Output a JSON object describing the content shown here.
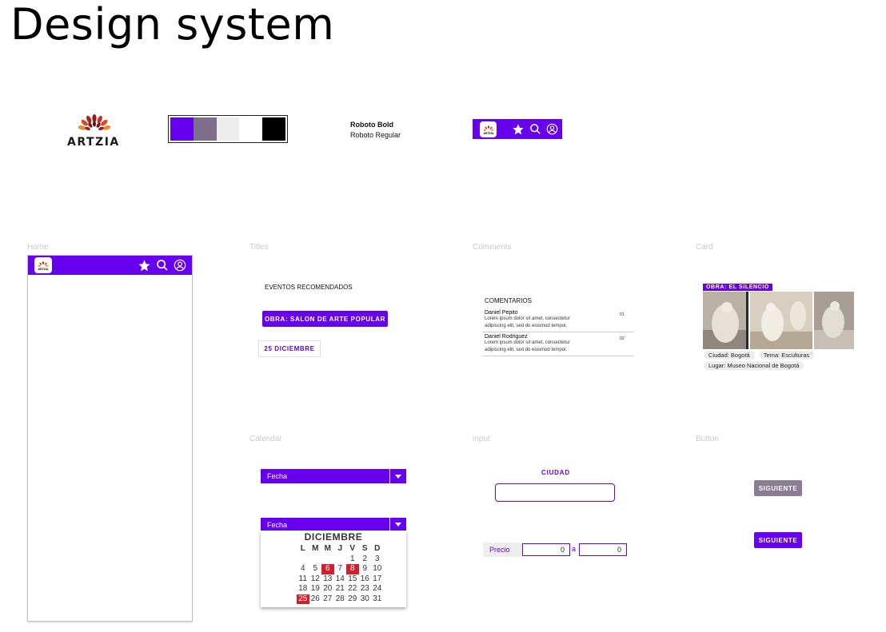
{
  "page": {
    "title": "Design system"
  },
  "brand": {
    "name": "ARTZIA",
    "palette": [
      "#6600ee",
      "#7d6e8c",
      "#ececec",
      "#ffffff",
      "#000000"
    ],
    "accent": "#6600ee",
    "highlight": "#d0202e"
  },
  "typography": {
    "bold": "Roboto  Bold",
    "regular": "Roboto  Regular"
  },
  "nav": {
    "logo_text": "ARTZIA",
    "icons": [
      "star-icon",
      "search-icon",
      "user-icon"
    ]
  },
  "sections": {
    "home": "Home",
    "titles": "Titles",
    "comments": "Comments",
    "card": "Card",
    "calendar": "Calendar",
    "input": "input",
    "button": "Button"
  },
  "titles": {
    "heading": "EVENTOS RECOMENDADOS",
    "primary_button": "OBRA: SALON DE ARTE POPULAR",
    "date_button": "25 DICIEMBRE"
  },
  "comments": {
    "heading": "COMENTARIOS",
    "items": [
      {
        "name": "Daniel Pepito",
        "body": "Lorem ipsum dolor sit amet, consectetur adipiscing elit, sed do eiusmod tempor.",
        "num": "01"
      },
      {
        "name": "Daniel Rodriguez",
        "body": "Lorem ipsum dolor sit amet, consectetur adipiscing elit, sed do eiusmod tempor.",
        "num": "02"
      }
    ]
  },
  "card": {
    "label": "OBRA: EL SILENCIO",
    "chips": [
      "Ciudad: Bogotá",
      "Tema: Esculturas",
      "Lugar: Museo Nacional de Bogotá"
    ]
  },
  "calendar": {
    "dropdown_label": "Fecha",
    "month": "DICIEMBRE",
    "weekdays": [
      "L",
      "M",
      "M",
      "J",
      "V",
      "S",
      "D"
    ],
    "days": [
      [
        "",
        "",
        "",
        "",
        "",
        "1",
        "2",
        "3"
      ],
      [
        "4",
        "5",
        "6",
        "7",
        "8",
        "9",
        "10"
      ],
      [
        "11",
        "12",
        "13",
        "14",
        "15",
        "16",
        "17"
      ],
      [
        "18",
        "19",
        "20",
        "21",
        "22",
        "23",
        "24"
      ],
      [
        "25",
        "26",
        "27",
        "28",
        "29",
        "30",
        "31"
      ]
    ],
    "highlighted": [
      "6",
      "8",
      "25"
    ]
  },
  "input": {
    "city_label": "CIUDAD",
    "city_value": "",
    "price_label": "Precio",
    "price_from": "0",
    "price_separator": "a",
    "price_to": "0"
  },
  "buttons": {
    "disabled": "SIGUIENTE",
    "enabled": "SIGUIENTE"
  }
}
